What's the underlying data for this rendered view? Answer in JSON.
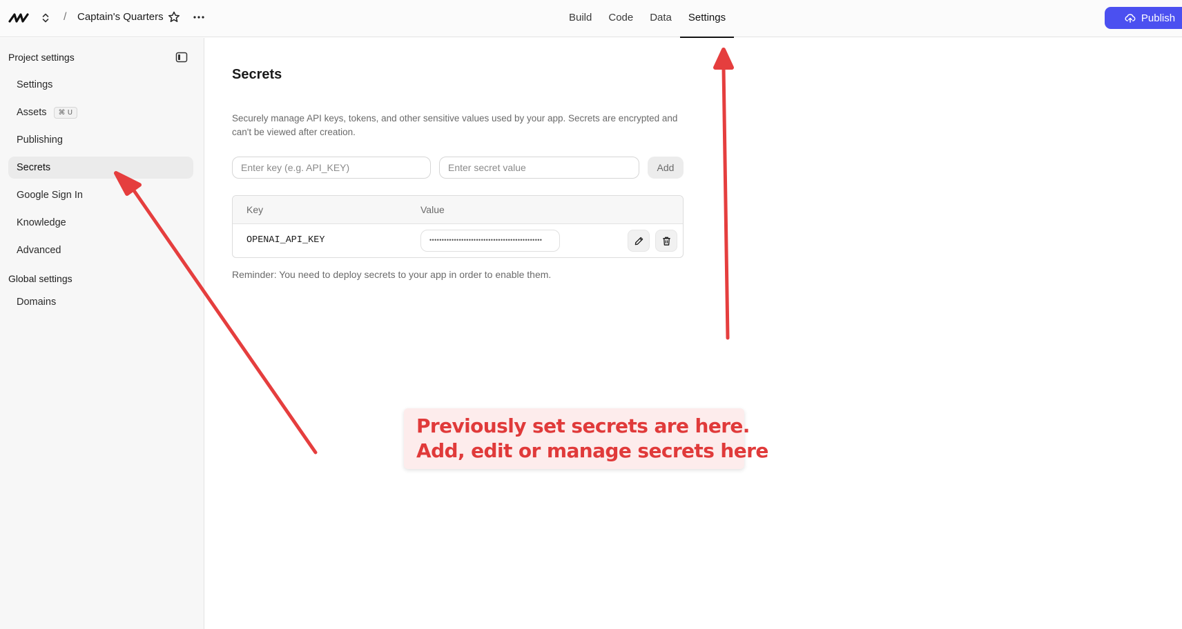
{
  "topbar": {
    "project_name": "Captain's Quarters",
    "separator": "/",
    "tabs": [
      {
        "label": "Build",
        "active": false
      },
      {
        "label": "Code",
        "active": false
      },
      {
        "label": "Data",
        "active": false
      },
      {
        "label": "Settings",
        "active": true
      }
    ],
    "publish_label": "Publish",
    "accent_color": "#4b50f0"
  },
  "sidebar": {
    "project_heading": "Project settings",
    "project_items": [
      {
        "label": "Settings"
      },
      {
        "label": "Assets",
        "shortcut": "⌘ U"
      },
      {
        "label": "Publishing"
      },
      {
        "label": "Secrets",
        "active": true
      },
      {
        "label": "Google Sign In"
      },
      {
        "label": "Knowledge"
      },
      {
        "label": "Advanced"
      }
    ],
    "global_heading": "Global settings",
    "global_items": [
      {
        "label": "Domains"
      }
    ]
  },
  "main": {
    "title": "Secrets",
    "description": "Securely manage API keys, tokens, and other sensitive values used by your app. Secrets are encrypted and can't be viewed after creation.",
    "key_placeholder": "Enter key (e.g. API_KEY)",
    "value_placeholder": "Enter secret value",
    "add_label": "Add",
    "table": {
      "headers": [
        "Key",
        "Value"
      ],
      "rows": [
        {
          "key": "OPENAI_API_KEY",
          "value": "••••••••••••••••••••••••••••••••••••••••••••••"
        }
      ]
    },
    "reminder": "Reminder: You need to deploy secrets to your app in order to enable them."
  },
  "annotation": {
    "line1": "Previously set secrets are here.",
    "line2": "Add, edit or manage secrets here",
    "color": "#e03a3a"
  }
}
